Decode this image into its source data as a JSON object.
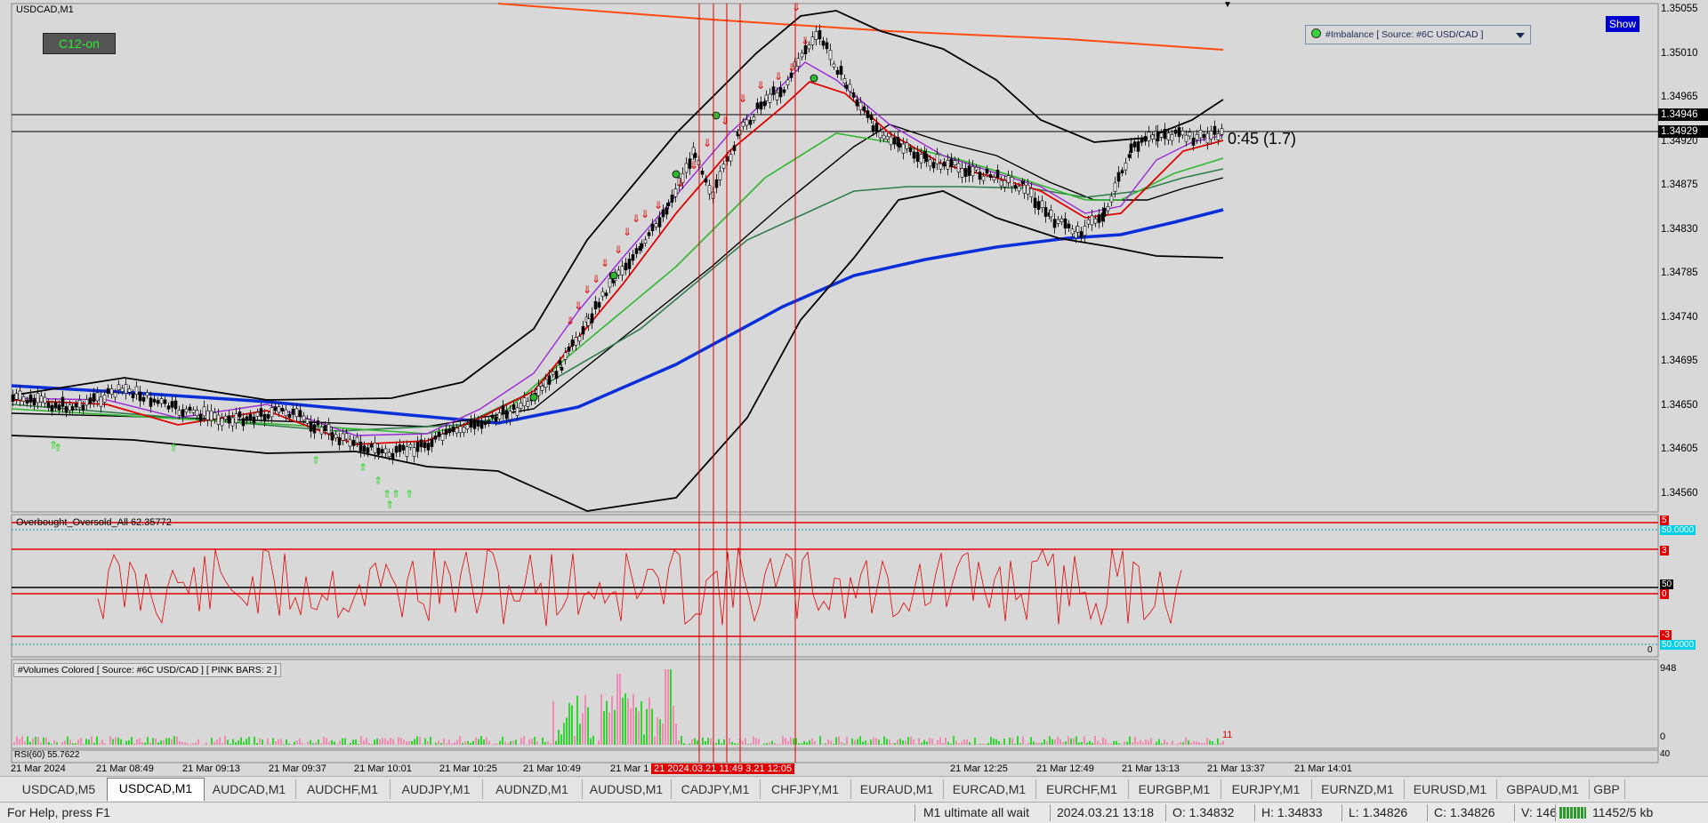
{
  "symbol_label": "USDCAD,M1",
  "badge": "C12-on",
  "imbalance_label": "#Imbalance [ Source: #6C USD/CAD ]",
  "show_button": "Show",
  "countdown": "0:45 (1.7)",
  "price_axis": [
    "1.35055",
    "1.35010",
    "1.34965",
    "1.34920",
    "1.34875",
    "1.34830",
    "1.34785",
    "1.34740",
    "1.34695",
    "1.34650",
    "1.34605",
    "1.34560"
  ],
  "price_tags": {
    "upper": "1.34946",
    "current": "1.34929"
  },
  "osc_label": "Overbought_Oversold_All 62.35772",
  "osc_axis": {
    "top": "5",
    "mid_upper": "3",
    "mid": "50",
    "zero": "0",
    "lower": "-3",
    "bottom": "0",
    "level_top": "50.0000",
    "level_bottom": "50.0000"
  },
  "vol_label": "#Volumes Colored [ Source: #6C USD/CAD ]   [ PINK BARS: 2 ]",
  "vol_axis": {
    "top": "948",
    "bottom": "0",
    "value": "11"
  },
  "rsi_label": "RSI(60) 55.7622",
  "rsi_axis": "40",
  "time_axis": [
    "21 Mar 2024",
    "21 Mar 08:49",
    "21 Mar 09:13",
    "21 Mar 09:37",
    "21 Mar 10:01",
    "21 Mar 10:25",
    "21 Mar 10:49",
    "21 Mar 1",
    "21 Mar 12:25",
    "21 Mar 12:49",
    "21 Mar 13:13",
    "21 Mar 13:37",
    "21 Mar 14:01"
  ],
  "time_highlight": "21 2024.03.21 11:49 3.21 12:05",
  "tabs": [
    "USDCAD,M5",
    "USDCAD,M1",
    "AUDCAD,M1",
    "AUDCHF,M1",
    "AUDJPY,M1",
    "AUDNZD,M1",
    "AUDUSD,M1",
    "CADJPY,M1",
    "CHFJPY,M1",
    "EURAUD,M1",
    "EURCAD,M1",
    "EURCHF,M1",
    "EURGBP,M1",
    "EURJPY,M1",
    "EURNZD,M1",
    "EURUSD,M1",
    "GBPAUD,M1",
    "GBP"
  ],
  "active_tab": "USDCAD,M1",
  "status": {
    "help": "For Help, press F1",
    "profile": "M1 ultimate all wait",
    "datetime": "2024.03.21 13:18",
    "open": "O: 1.34832",
    "high": "H: 1.34833",
    "low": "L: 1.34826",
    "close": "C: 1.34826",
    "volume": "V: 146",
    "traffic": "11452/5 kb"
  },
  "colors": {
    "bg": "#d8d8d8",
    "ma_blue": "#0a2fd8",
    "ma_red": "#e00000",
    "ma_green": "#2fb82f",
    "ma_dark_green": "#2e7d4a",
    "band_black": "#000000",
    "signal_red": "#e00000",
    "signal_green": "#22d822",
    "long_ma_orange": "#ff4a10"
  }
}
